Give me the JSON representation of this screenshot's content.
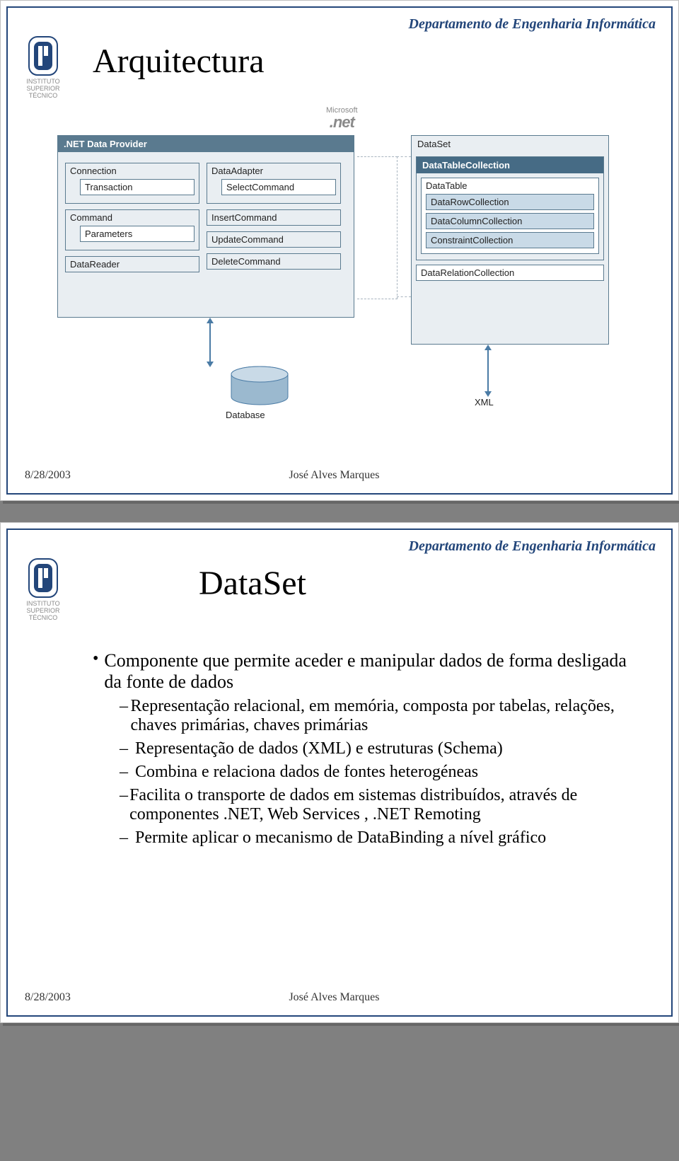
{
  "dept": "Departamento de Engenharia Informática",
  "logo_text": "INSTITUTO SUPERIOR TÉCNICO",
  "footer": {
    "date": "8/28/2003",
    "author": "José Alves Marques"
  },
  "slide1": {
    "title": "Arquitectura",
    "net_vendor": "Microsoft",
    "net_brand": ".net",
    "provider_title": ".NET Data Provider",
    "connection": "Connection",
    "transaction": "Transaction",
    "command": "Command",
    "parameters": "Parameters",
    "datareader": "DataReader",
    "dataadapter": "DataAdapter",
    "selectcmd": "SelectCommand",
    "insertcmd": "InsertCommand",
    "updatecmd": "UpdateCommand",
    "deletecmd": "DeleteCommand",
    "dataset": "DataSet",
    "datatablecollection": "DataTableCollection",
    "datatable": "DataTable",
    "datarowcollection": "DataRowCollection",
    "datacolumncollection": "DataColumnCollection",
    "constraintcollection": "ConstraintCollection",
    "datarelationcollection": "DataRelationCollection",
    "database": "Database",
    "xml": "XML"
  },
  "slide2": {
    "title": "DataSet",
    "b1": "Componente que permite aceder e manipular dados de forma desligada da fonte de dados",
    "b2_1": "Representação relacional, em memória, composta por tabelas, relações, chaves primárias, chaves primárias",
    "b2_2": "Representação de dados (XML) e estruturas (Schema)",
    "b2_3": "Combina e relaciona dados de fontes heterogéneas",
    "b2_4": "Facilita o transporte de dados em sistemas distribuídos, através de componentes .NET, Web Services , .NET Remoting",
    "b2_5": "Permite aplicar o mecanismo de DataBinding a nível gráfico"
  }
}
